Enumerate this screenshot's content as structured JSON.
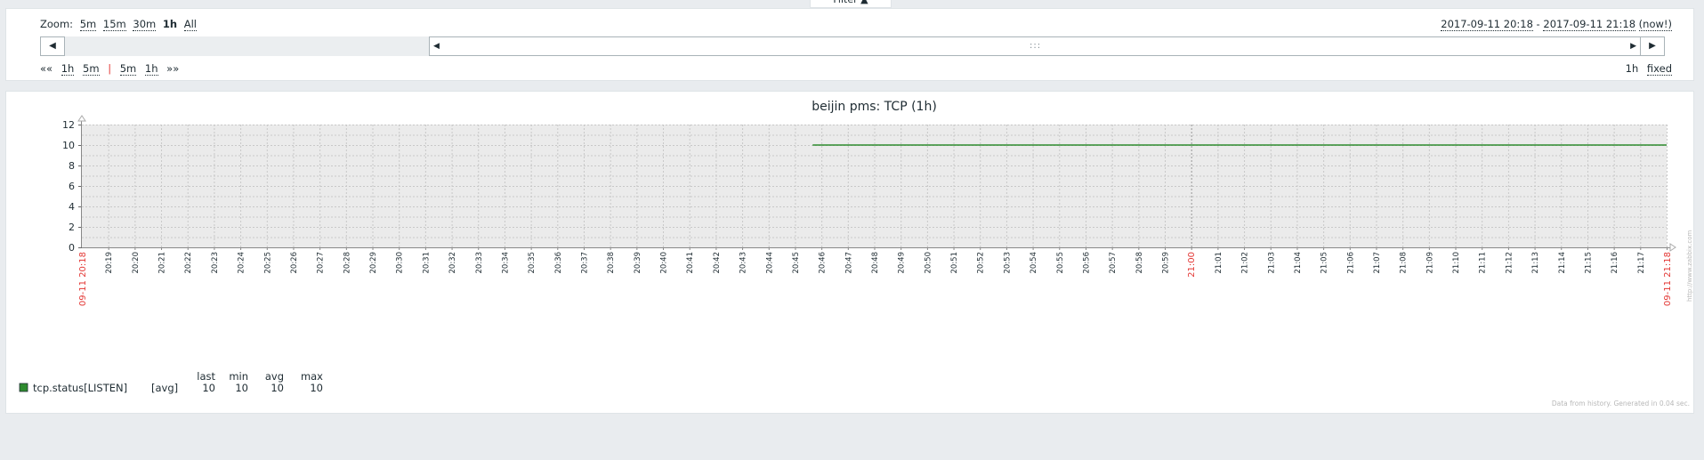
{
  "filter_tab": {
    "label": "Filter ▲"
  },
  "zoom": {
    "label": "Zoom:",
    "options": [
      "5m",
      "15m",
      "30m",
      "1h",
      "All"
    ],
    "selected": "1h"
  },
  "period": {
    "from": "2017-09-11 20:18",
    "separator": " - ",
    "to": "2017-09-11 21:18",
    "now": "(now!)"
  },
  "scroll": {
    "left_icon": "triangle-left-icon",
    "right_icon": "triangle-right-icon",
    "handle_icon": "grip-icon"
  },
  "nav": {
    "back_all": "««",
    "back": [
      "1h",
      "5m"
    ],
    "separator": "|",
    "forward": [
      "5m",
      "1h"
    ],
    "forward_all": "»»"
  },
  "period_length": {
    "value": "1h",
    "fixed_label": "fixed"
  },
  "chart_data": {
    "type": "line",
    "title": "beijin pms: TCP (1h)",
    "x_start": "20:18",
    "x_end": "21:18",
    "x_ticks": [
      "20:19",
      "20:20",
      "20:21",
      "20:22",
      "20:23",
      "20:24",
      "20:25",
      "20:26",
      "20:27",
      "20:28",
      "20:29",
      "20:30",
      "20:31",
      "20:32",
      "20:33",
      "20:34",
      "20:35",
      "20:36",
      "20:37",
      "20:38",
      "20:39",
      "20:40",
      "20:41",
      "20:42",
      "20:43",
      "20:44",
      "20:45",
      "20:46",
      "20:47",
      "20:48",
      "20:49",
      "20:50",
      "20:51",
      "20:52",
      "20:53",
      "20:54",
      "20:55",
      "20:56",
      "20:57",
      "20:58",
      "20:59",
      "21:00",
      "21:01",
      "21:02",
      "21:03",
      "21:04",
      "21:05",
      "21:06",
      "21:07",
      "21:08",
      "21:09",
      "21:10",
      "21:11",
      "21:12",
      "21:13",
      "21:14",
      "21:15",
      "21:16",
      "21:17",
      "21:18"
    ],
    "x_highlight": "21:00",
    "x_edge_start_label": "09-11 20:18",
    "x_edge_end_label": "09-11 21:18",
    "y_ticks": [
      0,
      2,
      4,
      6,
      8,
      10,
      12
    ],
    "ylim": [
      0,
      12
    ],
    "grid": true,
    "series": [
      {
        "name": "tcp.status[LISTEN]",
        "color": "#2e8b2e",
        "points": [
          {
            "x": "20:45:40",
            "y": 10
          },
          {
            "x": "21:18",
            "y": 10
          }
        ]
      }
    ],
    "legend": {
      "headers": [
        "last",
        "min",
        "avg",
        "max"
      ],
      "rows": [
        {
          "name": "tcp.status[LISTEN]",
          "func": "[avg]",
          "last": "10",
          "min": "10",
          "avg": "10",
          "max": "10",
          "color": "#2e8b2e"
        }
      ]
    },
    "watermark": "http://www.zabbix.com",
    "footer": "Data from history. Generated in 0.04 sec."
  }
}
